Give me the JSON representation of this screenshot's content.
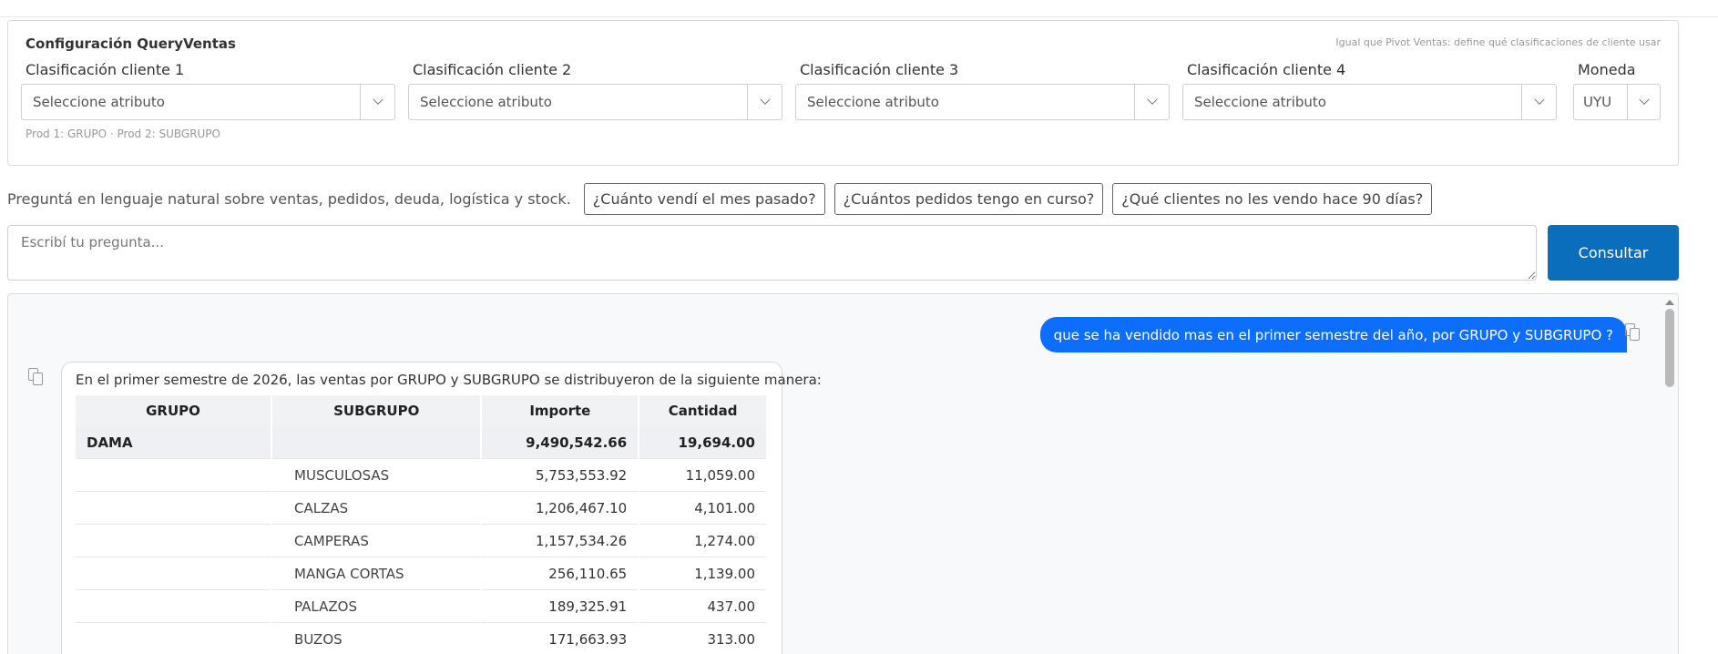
{
  "config": {
    "title": "Configuración QueryVentas",
    "hint": "Igual que Pivot Ventas: define qué clasificaciones de cliente usar",
    "fields": [
      {
        "label": "Clasificación cliente 1",
        "value": "Seleccione atributo"
      },
      {
        "label": "Clasificación cliente 2",
        "value": "Seleccione atributo"
      },
      {
        "label": "Clasificación cliente 3",
        "value": "Seleccione atributo"
      },
      {
        "label": "Clasificación cliente 4",
        "value": "Seleccione atributo"
      }
    ],
    "currency": {
      "label": "Moneda",
      "value": "UYU"
    },
    "footer": "Prod 1: GRUPO · Prod 2: SUBGRUPO"
  },
  "ask": {
    "intro": "Preguntá en lenguaje natural sobre ventas, pedidos, deuda, logística y stock.",
    "suggestions": [
      "¿Cuánto vendí el mes pasado?",
      "¿Cuántos pedidos tengo en curso?",
      "¿Qué clientes no les vendo hace 90 días?"
    ],
    "placeholder": "Escribí tu pregunta...",
    "submit_label": "Consultar"
  },
  "chat": {
    "user_message": "que se ha vendido mas en el primer semestre del año, por GRUPO y SUBGRUPO ?",
    "bot_intro": "En el primer semestre de 2026, las ventas por GRUPO y SUBGRUPO se distribuyeron de la siguiente manera:",
    "table": {
      "headers": [
        "GRUPO",
        "SUBGRUPO",
        "Importe",
        "Cantidad"
      ],
      "group_row": {
        "grupo": "DAMA",
        "subgrupo": "",
        "importe": "9,490,542.66",
        "cantidad": "19,694.00"
      },
      "rows": [
        {
          "grupo": "",
          "subgrupo": "MUSCULOSAS",
          "importe": "5,753,553.92",
          "cantidad": "11,059.00"
        },
        {
          "grupo": "",
          "subgrupo": "CALZAS",
          "importe": "1,206,467.10",
          "cantidad": "4,101.00"
        },
        {
          "grupo": "",
          "subgrupo": "CAMPERAS",
          "importe": "1,157,534.26",
          "cantidad": "1,274.00"
        },
        {
          "grupo": "",
          "subgrupo": "MANGA CORTAS",
          "importe": "256,110.65",
          "cantidad": "1,139.00"
        },
        {
          "grupo": "",
          "subgrupo": "PALAZOS",
          "importe": "189,325.91",
          "cantidad": "437.00"
        },
        {
          "grupo": "",
          "subgrupo": "BUZOS",
          "importe": "171,663.93",
          "cantidad": "313.00"
        }
      ]
    }
  },
  "icons": {
    "copy": "copy-icon",
    "dropdown": "chevron-down-icon"
  },
  "colors": {
    "primary_button": "#0a6ebd",
    "user_bubble": "#0d6efd"
  }
}
